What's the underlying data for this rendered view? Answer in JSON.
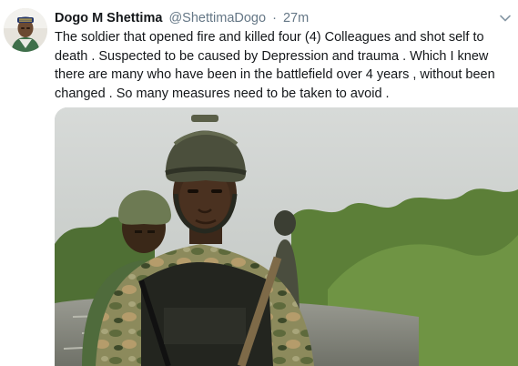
{
  "tweet": {
    "author": {
      "display_name": "Dogo M Shettima",
      "handle": "@ShettimaDogo",
      "avatar_icon": "profile-photo"
    },
    "separator": "·",
    "timestamp": "27m",
    "text": "The soldier that opened fire and killed four (4) Colleagues and shot self to death . Suspected to be caused by Depression and trauma .  Which I knew there are many who have been in the battlefield over 4 years , without been changed . So many measures need to be taken to avoid .",
    "menu_icon": "chevron-down-icon",
    "media": {
      "description_icon": "photo",
      "colors": {
        "sky": "#cfd3d1",
        "vegetation": "#5f8a3a",
        "water": "#8d8f86",
        "camouflage": "#7a7a4e",
        "helmet": "#4b4f3c"
      }
    }
  }
}
